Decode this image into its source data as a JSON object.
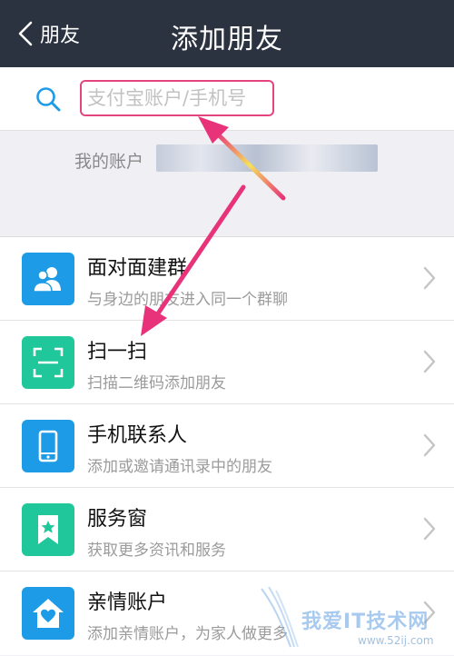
{
  "header": {
    "back_label": "朋友",
    "title": "添加朋友"
  },
  "search": {
    "placeholder": "支付宝账户/手机号",
    "value": ""
  },
  "account": {
    "label": "我的账户",
    "value_obscured": true
  },
  "menu": {
    "items": [
      {
        "title": "面对面建群",
        "subtitle": "与身边的朋友进入同一个群聊",
        "icon": "group-icon",
        "color": "#1e9be6"
      },
      {
        "title": "扫一扫",
        "subtitle": "扫描二维码添加朋友",
        "icon": "scan-icon",
        "color": "#1fc79a"
      },
      {
        "title": "手机联系人",
        "subtitle": "添加或邀请通讯录中的朋友",
        "icon": "phone-icon",
        "color": "#1e9be6"
      },
      {
        "title": "服务窗",
        "subtitle": "获取更多资讯和服务",
        "icon": "ribbon-star-icon",
        "color": "#1fc79a"
      },
      {
        "title": "亲情账户",
        "subtitle": "添加亲情账户，为家人做更多",
        "icon": "home-heart-icon",
        "color": "#1e9be6"
      }
    ]
  },
  "watermark": {
    "text": "我爱IT技术网",
    "url": "www.52ij.com"
  },
  "colors": {
    "topbar": "#2b3240",
    "accent_blue": "#1e9be6",
    "accent_green": "#1fc79a",
    "annotation": "#e8337a"
  }
}
